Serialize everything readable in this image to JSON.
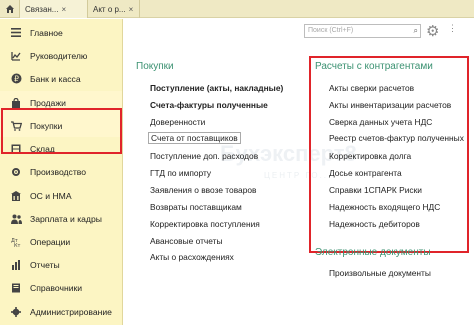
{
  "tabs": [
    {
      "label": "Связан...",
      "close": "×"
    },
    {
      "label": "Акт о р...",
      "close": "×"
    }
  ],
  "home_icon": "home-icon",
  "search": {
    "placeholder": "Поиск (Ctrl+F)"
  },
  "sidebar": {
    "items": [
      {
        "label": "Главное",
        "icon": "menu-icon"
      },
      {
        "label": "Руководителю",
        "icon": "chart-icon"
      },
      {
        "label": "Банк и касса",
        "icon": "ruble-icon"
      },
      {
        "label": "Продажи",
        "icon": "bag-icon"
      },
      {
        "label": "Покупки",
        "icon": "cart-icon"
      },
      {
        "label": "Склад",
        "icon": "warehouse-icon"
      },
      {
        "label": "Производство",
        "icon": "factory-icon"
      },
      {
        "label": "ОС и НМА",
        "icon": "building-icon"
      },
      {
        "label": "Зарплата и кадры",
        "icon": "people-icon"
      },
      {
        "label": "Операции",
        "icon": "operations-icon"
      },
      {
        "label": "Отчеты",
        "icon": "report-icon"
      },
      {
        "label": "Справочники",
        "icon": "book-icon"
      },
      {
        "label": "Администрирование",
        "icon": "gear-icon"
      }
    ]
  },
  "purchases": {
    "title": "Покупки",
    "links": [
      "Поступление (акты, накладные)",
      "Счета-фактуры полученные",
      "Доверенности",
      "Счета от поставщиков",
      "Поступление доп. расходов",
      "ГТД по импорту",
      "Заявления о ввозе товаров",
      "Возвраты поставщикам",
      "Корректировка поступления",
      "Авансовые отчеты",
      "Акты о расхождениях"
    ]
  },
  "settlements": {
    "title": "Расчеты с контрагентами",
    "links": [
      "Акты сверки расчетов",
      "Акты инвентаризации расчетов",
      "Сверка данных учета НДС",
      "Реестр счетов-фактур полученных",
      "Корректировка долга",
      "Досье контрагента",
      "Справки 1СПАРК Риски",
      "Надежность входящего НДС",
      "Надежность дебиторов"
    ]
  },
  "edocs": {
    "title": "Электронные документы",
    "links": [
      "Произвольные документы"
    ]
  },
  "watermark": {
    "text": "Бухэксперт8",
    "sub": "ЦЕНТР ГО..."
  }
}
